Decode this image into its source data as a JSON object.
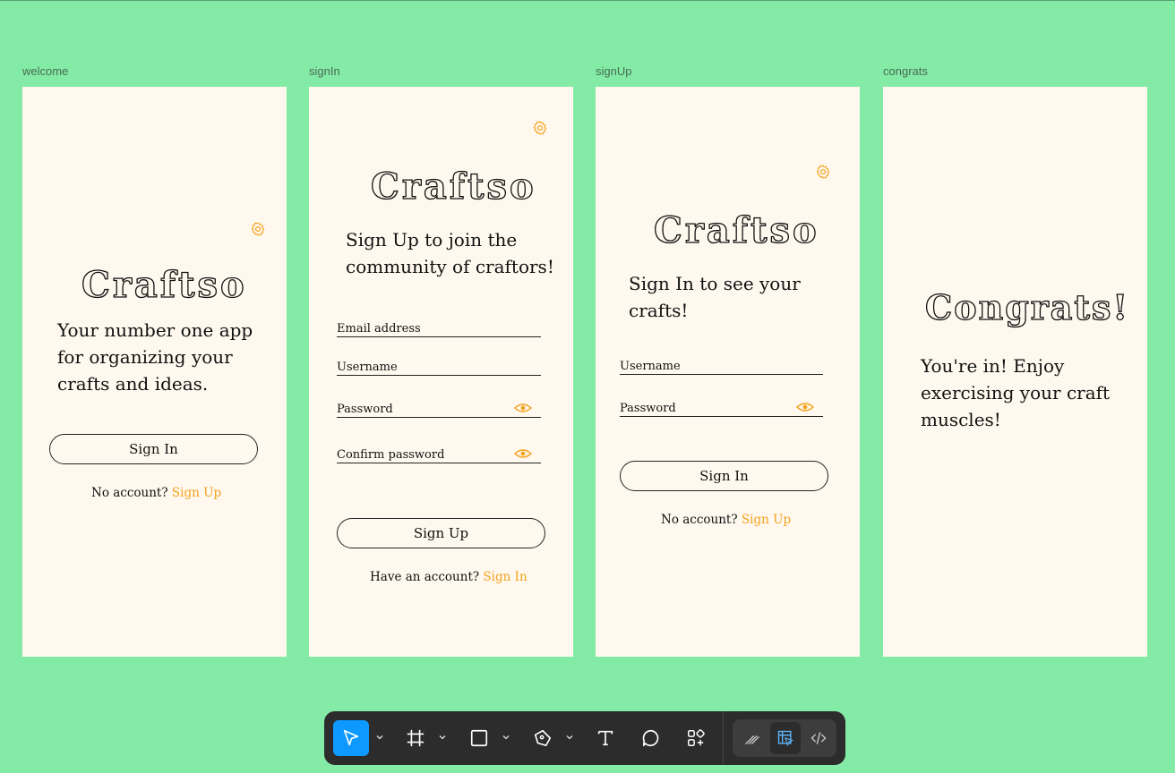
{
  "frames": {
    "welcome": {
      "label": "welcome",
      "logo": "Craftso",
      "heading": "Your number one app for organizing your crafts and ideas.",
      "sign_in_button": "Sign In",
      "footer_text": "No account?",
      "footer_link": "Sign Up"
    },
    "signin": {
      "label": "signIn",
      "logo": "Craftso",
      "heading": "Sign Up to join the community of craftors!",
      "email_label": "Email address",
      "username_label": "Username",
      "password_label": "Password",
      "confirm_label": "Confirm password",
      "sign_up_button": "Sign Up",
      "footer_text": "Have an account?",
      "footer_link": "Sign In"
    },
    "signup": {
      "label": "signUp",
      "logo": "Craftso",
      "heading": "Sign In to see your crafts!",
      "username_label": "Username",
      "password_label": "Password",
      "sign_in_button": "Sign In",
      "footer_text": "No account?",
      "footer_link": "Sign Up"
    },
    "congrats": {
      "label": "congrats",
      "title": "Congrats!",
      "heading": "You're in! Enjoy exercising your craft muscles!"
    }
  },
  "toolbar": {
    "tools": [
      "move-tool",
      "frame-tool",
      "shape-tool",
      "pen-tool",
      "text-tool",
      "comment-tool",
      "actions-tool"
    ],
    "modes": [
      "draw-mode",
      "design-mode",
      "dev-mode"
    ]
  },
  "colors": {
    "canvas": "#83eba5",
    "frame": "#fff8ee",
    "accent": "#f2a21b",
    "toolbar": "#2c2c2c",
    "active": "#0d99ff"
  }
}
